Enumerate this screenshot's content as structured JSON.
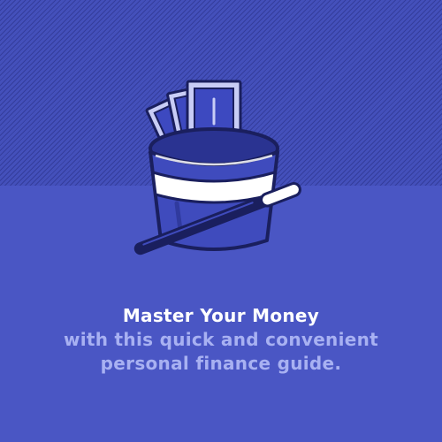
{
  "headline": "Master Your Money",
  "subline_1": "with this quick and convenient",
  "subline_2": "personal finance guide.",
  "bill_symbol": "$",
  "colors": {
    "background": "#4a56c4",
    "pattern_band": "#4450bb",
    "headline": "#ffffff",
    "subline": "#a8b1f2",
    "outline": "#1a1f5e",
    "hat_blue": "#3f4bbd",
    "money_blue": "#3d49c0",
    "money_light": "#c8cdf6"
  },
  "icons": [
    "magic-hat-icon",
    "money-bills-icon",
    "magic-wand-icon"
  ]
}
